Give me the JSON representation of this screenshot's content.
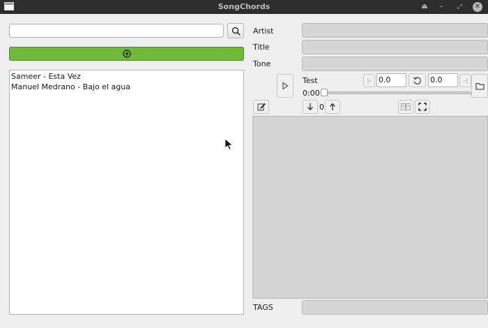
{
  "window": {
    "title": "SongChords"
  },
  "search": {
    "value": "",
    "placeholder": ""
  },
  "songs": [
    "Sameer - Esta Vez",
    "Manuel Medrano - Bajo el agua"
  ],
  "details": {
    "artist_label": "Artist",
    "title_label": "Title",
    "tone_label": "Tone",
    "tags_label": "TAGS",
    "artist_value": "",
    "title_value": "",
    "tone_value": "",
    "tags_value": ""
  },
  "player": {
    "track_name": "Test",
    "start_value": "0.0",
    "end_value": "0.0",
    "time": "0:00",
    "transpose_value": "0",
    "progress_fraction": 0
  },
  "colors": {
    "add_button": "#6fba38",
    "titlebar": "#2d2d2d",
    "disabled_field": "#d6d6d6"
  },
  "icons": {
    "search": "search-icon",
    "add": "plus-circle-icon",
    "play": "play-icon",
    "edit": "pencil-icon",
    "folder": "folder-icon",
    "reset": "reset-icon",
    "down": "arrow-down-icon",
    "up": "arrow-up-icon",
    "columns": "columns-icon",
    "fullscreen": "fullscreen-icon"
  }
}
